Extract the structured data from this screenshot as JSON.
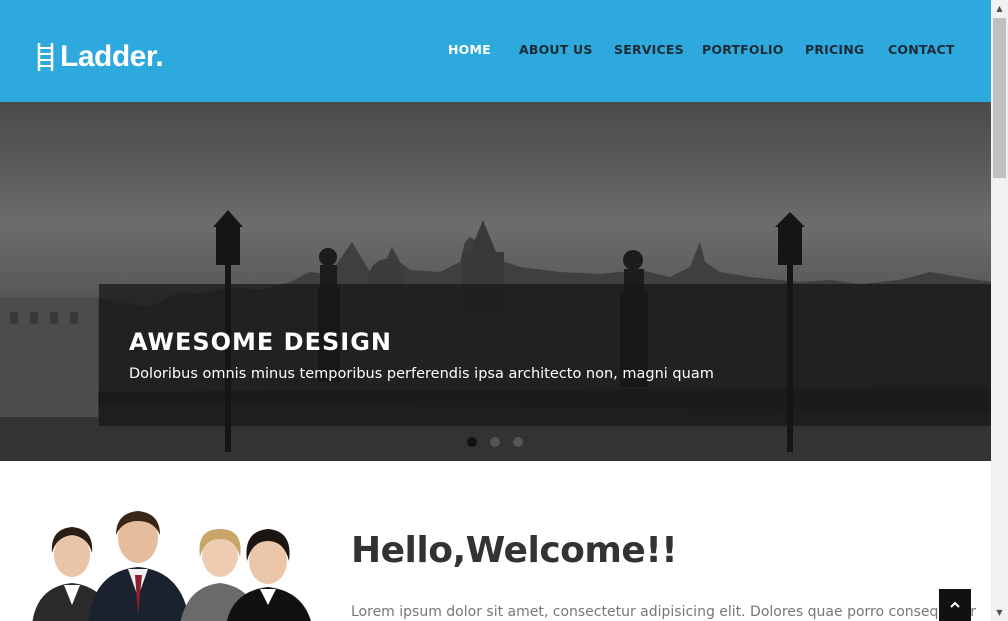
{
  "brand": {
    "name": "Ladder",
    "icon": "ladder-icon",
    "accent": "#2ea9de"
  },
  "nav": {
    "items": [
      {
        "label": "HOME",
        "active": true
      },
      {
        "label": "ABOUT US",
        "active": false
      },
      {
        "label": "SERVICES",
        "active": false
      },
      {
        "label": "PORTFOLIO",
        "active": false
      },
      {
        "label": "PRICING",
        "active": false
      },
      {
        "label": "CONTACT",
        "active": false
      }
    ]
  },
  "hero": {
    "title": "AWESOME DESIGN",
    "subtitle": "Doloribus omnis minus temporibus perferendis ipsa architecto non, magni quam",
    "slides": 3,
    "active_slide": 1
  },
  "welcome": {
    "title": "Hello,Welcome!!",
    "body": "Lorem ipsum dolor sit amet, consectetur adipisicing elit. Dolores quae porro consequatur"
  },
  "back_to_top": {
    "icon": "chevron-up-icon"
  },
  "scrollbar": {
    "up_icon": "scroll-up-arrow-icon",
    "down_icon": "scroll-down-arrow-icon"
  }
}
